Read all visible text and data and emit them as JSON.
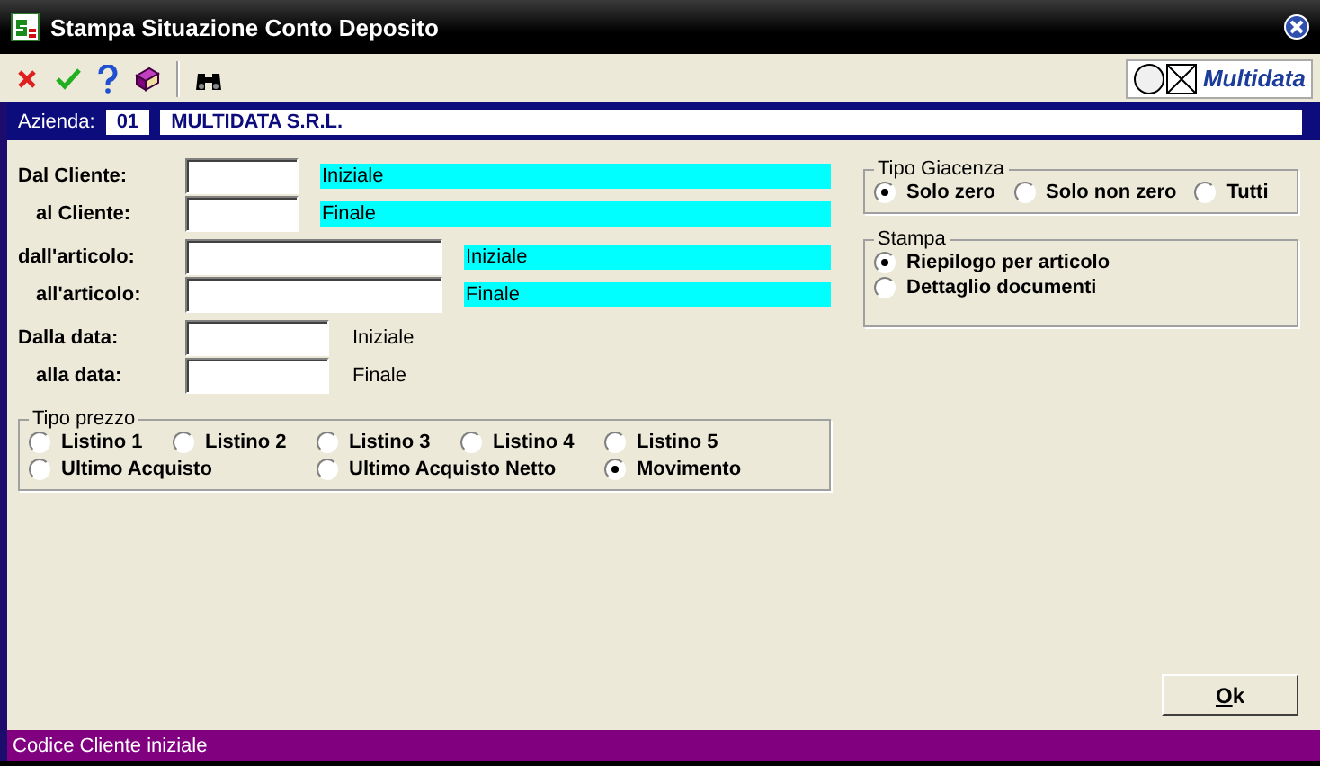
{
  "window": {
    "title": "Stampa Situazione Conto Deposito"
  },
  "toolbar": {
    "logo": "Multidata"
  },
  "company": {
    "label": "Azienda:",
    "code": "01",
    "name": "MULTIDATA S.R.L."
  },
  "ranges": [
    {
      "kind": "client",
      "rows": [
        {
          "label": "Dal Cliente:",
          "hint": "Iniziale"
        },
        {
          "label": "al Cliente:",
          "hint": "Finale"
        }
      ]
    },
    {
      "kind": "article",
      "rows": [
        {
          "label": "dall'articolo:",
          "hint": "Iniziale"
        },
        {
          "label": "all'articolo:",
          "hint": "Finale"
        }
      ]
    },
    {
      "kind": "date",
      "rows": [
        {
          "label": "Dalla data:",
          "hint": "Iniziale"
        },
        {
          "label": "alla data:",
          "hint": "Finale"
        }
      ]
    }
  ],
  "tipo_prezzo": {
    "title": "Tipo prezzo",
    "options": [
      {
        "label": "Listino 1",
        "selected": false,
        "kind": "single"
      },
      {
        "label": "Listino 2",
        "selected": false,
        "kind": "single"
      },
      {
        "label": "Listino 3",
        "selected": false,
        "kind": "single"
      },
      {
        "label": "Listino 4",
        "selected": false,
        "kind": "single"
      },
      {
        "label": "Listino 5",
        "selected": false,
        "kind": "single"
      },
      {
        "label": "Ultimo Acquisto",
        "selected": false,
        "kind": "double"
      },
      {
        "label": "Ultimo Acquisto Netto",
        "selected": false,
        "kind": "double"
      },
      {
        "label": "Movimento",
        "selected": true,
        "kind": "single"
      }
    ]
  },
  "tipo_giacenza": {
    "title": "Tipo Giacenza",
    "options": [
      {
        "label": "Solo zero",
        "selected": true
      },
      {
        "label": "Solo non zero",
        "selected": false
      },
      {
        "label": "Tutti",
        "selected": false
      }
    ]
  },
  "stampa": {
    "title": "Stampa",
    "options": [
      {
        "label": "Riepilogo per articolo",
        "selected": true
      },
      {
        "label": "Dettaglio documenti",
        "selected": false
      }
    ]
  },
  "ok_button": "Ok",
  "status_bar": "Codice Cliente iniziale"
}
